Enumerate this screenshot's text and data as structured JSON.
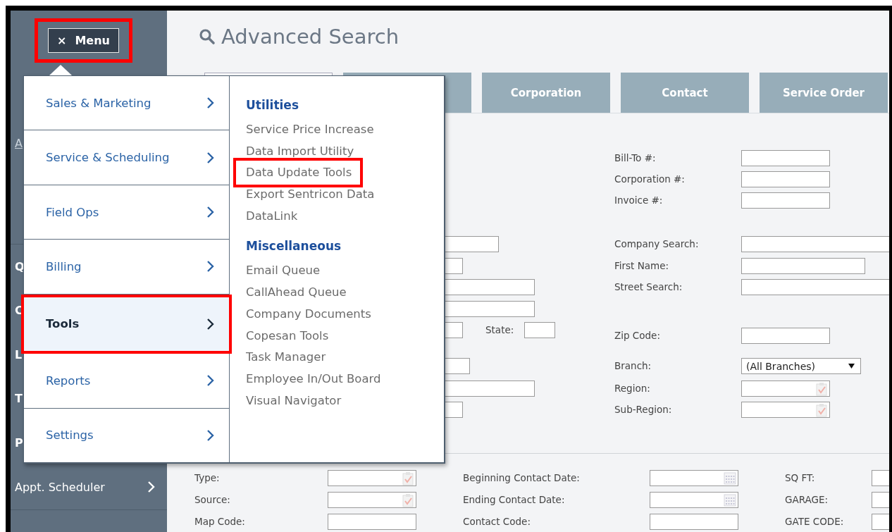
{
  "sidebar": {
    "menu_button": {
      "icon": "×",
      "label": "Menu",
      "highlighted": true
    },
    "items": [
      {
        "text": "A",
        "kind": "link"
      },
      {
        "text": "Q",
        "kind": "entry"
      },
      {
        "text": "C",
        "kind": "entry"
      },
      {
        "text": "L",
        "kind": "entry"
      },
      {
        "text": "T",
        "kind": "entry"
      },
      {
        "text": "P",
        "kind": "entry"
      },
      {
        "text": "Appt. Scheduler",
        "kind": "nav"
      }
    ]
  },
  "header": {
    "title": "Advanced Search"
  },
  "tabs": [
    {
      "selected": true
    },
    {
      "selected": false
    },
    {
      "label": "Corporation",
      "selected": false
    },
    {
      "label": "Contact",
      "selected": false
    },
    {
      "label": "Service Order",
      "selected": false
    }
  ],
  "form": {
    "left_column": [
      {
        "kind": "input"
      },
      {
        "kind": "input"
      },
      {
        "kind": "input"
      },
      {
        "kind": "input"
      },
      {
        "kind": "input",
        "label": "State:"
      },
      {
        "kind": "input"
      },
      {
        "kind": "input"
      },
      {
        "kind": "input"
      }
    ],
    "right_column": [
      {
        "label": "Bill-To #:",
        "kind": "text"
      },
      {
        "label": "Corporation #:",
        "kind": "text"
      },
      {
        "label": "Invoice #:",
        "kind": "text"
      },
      {
        "kind": "blank"
      },
      {
        "label": "Company Search:",
        "kind": "text"
      },
      {
        "label": "First Name:",
        "kind": "text"
      },
      {
        "label": "Street Search:",
        "kind": "text"
      },
      {
        "kind": "blank"
      },
      {
        "label": "Zip Code:",
        "kind": "text"
      },
      {
        "label": "Branch:",
        "kind": "select",
        "value": "(All Branches)"
      },
      {
        "label": "Region:",
        "kind": "picker"
      },
      {
        "label": "Sub-Region:",
        "kind": "picker"
      }
    ],
    "bottom_rows": [
      [
        {
          "label": "Type:",
          "kind": "picker"
        },
        {
          "label": "Beginning Contact Date:",
          "kind": "date"
        },
        {
          "label": "SQ FT:",
          "kind": "text"
        }
      ],
      [
        {
          "label": "Source:",
          "kind": "picker"
        },
        {
          "label": "Ending Contact Date:",
          "kind": "date"
        },
        {
          "label": "GARAGE:",
          "kind": "text"
        }
      ],
      [
        {
          "label": "Map Code:",
          "kind": "text"
        },
        {
          "label": "Contact Code:",
          "kind": "text"
        },
        {
          "label": "GATE CODE:",
          "kind": "text"
        }
      ]
    ]
  },
  "menu": {
    "categories": [
      {
        "label": "Sales & Marketing",
        "selected": false,
        "highlighted": false
      },
      {
        "label": "Service & Scheduling",
        "selected": false,
        "highlighted": false
      },
      {
        "label": "Field Ops",
        "selected": false,
        "highlighted": false
      },
      {
        "label": "Billing",
        "selected": false,
        "highlighted": false
      },
      {
        "label": "Tools",
        "selected": true,
        "highlighted": true
      },
      {
        "label": "Reports",
        "selected": false,
        "highlighted": false
      },
      {
        "label": "Settings",
        "selected": false,
        "highlighted": false
      }
    ],
    "sections": [
      {
        "heading": "Utilities",
        "items": [
          {
            "label": "Service Price Increase",
            "highlighted": false
          },
          {
            "label": "Data Import Utility",
            "highlighted": false
          },
          {
            "label": "Data Update Tools",
            "highlighted": true
          },
          {
            "label": "Export Sentricon Data",
            "highlighted": false
          },
          {
            "label": "DataLink",
            "highlighted": false
          }
        ]
      },
      {
        "heading": "Miscellaneous",
        "items": [
          {
            "label": "Email Queue",
            "highlighted": false
          },
          {
            "label": "CallAhead Queue",
            "highlighted": false
          },
          {
            "label": "Company Documents",
            "highlighted": false
          },
          {
            "label": "Copesan Tools",
            "highlighted": false
          },
          {
            "label": "Task Manager",
            "highlighted": false
          },
          {
            "label": "Employee In/Out Board",
            "highlighted": false
          },
          {
            "label": "Visual Navigator",
            "highlighted": false
          }
        ]
      }
    ]
  }
}
